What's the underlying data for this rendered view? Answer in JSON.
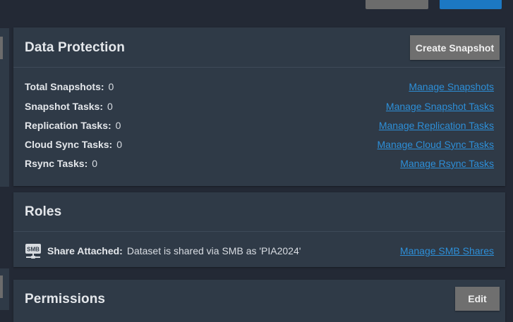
{
  "colors": {
    "page_bg": "#232935",
    "card_bg": "#2f3a47",
    "link": "#2d8fd8",
    "button_gray": "#6f6f6f",
    "button_blue": "#1c78c3"
  },
  "data_protection": {
    "title": "Data Protection",
    "create_snapshot_label": "Create Snapshot",
    "rows": [
      {
        "label": "Total Snapshots:",
        "value": "0",
        "link": "Manage Snapshots"
      },
      {
        "label": "Snapshot Tasks:",
        "value": "0",
        "link": "Manage Snapshot Tasks"
      },
      {
        "label": "Replication Tasks:",
        "value": "0",
        "link": "Manage Replication Tasks"
      },
      {
        "label": "Cloud Sync Tasks:",
        "value": "0",
        "link": "Manage Cloud Sync Tasks"
      },
      {
        "label": "Rsync Tasks:",
        "value": "0",
        "link": "Manage Rsync Tasks"
      }
    ]
  },
  "roles": {
    "title": "Roles",
    "share_icon": "smb-share-icon",
    "share_icon_text": "SMB",
    "share_label": "Share Attached:",
    "share_text": "Dataset is shared via SMB as 'PIA2024'",
    "link": "Manage SMB Shares"
  },
  "permissions": {
    "title": "Permissions",
    "edit_label": "Edit"
  }
}
